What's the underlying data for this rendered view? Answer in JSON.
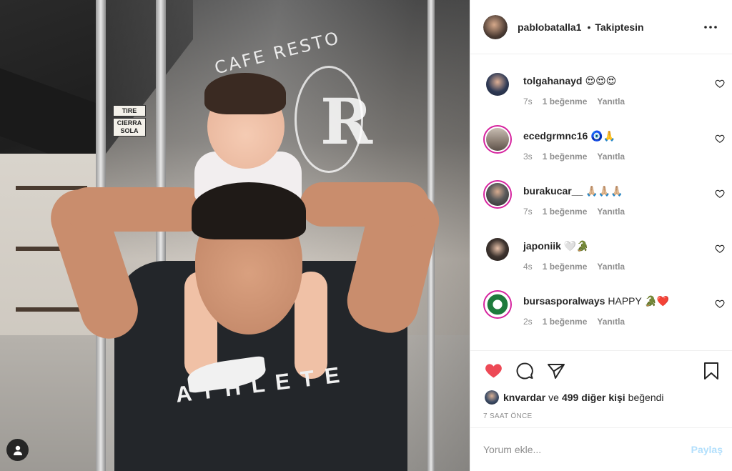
{
  "photo": {
    "sign_text": "CAFE RESTO",
    "logo_letter": "R",
    "tag_1": "TIRE",
    "tag_2a": "CIERRA",
    "tag_2b": "SOLA",
    "shirt_text": "ATHLETE"
  },
  "header": {
    "username": "pablobatalla1",
    "separator": "•",
    "follow_label": "Takiptesin"
  },
  "comments": [
    {
      "user": "tolgahanayd",
      "text": "😍😍😍",
      "time": "7s",
      "likes": "1 beğenme",
      "reply": "Yanıtla",
      "avatar_color": "#2f3a55",
      "story": false
    },
    {
      "user": "ecedgrmnc16",
      "text": "🧿🙏",
      "time": "3s",
      "likes": "1 beğenme",
      "reply": "Yanıtla",
      "avatar_color": "#9a8f86",
      "story": true
    },
    {
      "user": "burakucar__",
      "text": "🙏🏼🙏🏼🙏🏼",
      "time": "7s",
      "likes": "1 beğenme",
      "reply": "Yanıtla",
      "avatar_color": "#5b5b5b",
      "story": true
    },
    {
      "user": "japoniik",
      "text": "🤍🐊",
      "time": "4s",
      "likes": "1 beğenme",
      "reply": "Yanıtla",
      "avatar_color": "#3f3530",
      "story": false
    },
    {
      "user": "bursasporalways",
      "text": "HAPPY 🐊❤️",
      "time": "2s",
      "likes": "1 beğenme",
      "reply": "Yanıtla",
      "avatar_color": "#1e7a3c",
      "story": true
    }
  ],
  "likes": {
    "user": "knvardar",
    "connector": "ve",
    "others": "499 diğer kişi",
    "suffix": "beğendi"
  },
  "timestamp": "7 SAAT ÖNCE",
  "comment_box": {
    "placeholder": "Yorum ekle...",
    "post_label": "Paylaş"
  },
  "colors": {
    "like_red": "#ed4956",
    "text": "#262626",
    "muted": "#8e8e8e",
    "post_disabled": "#b2dffc",
    "story_ring": "#d6249f"
  }
}
